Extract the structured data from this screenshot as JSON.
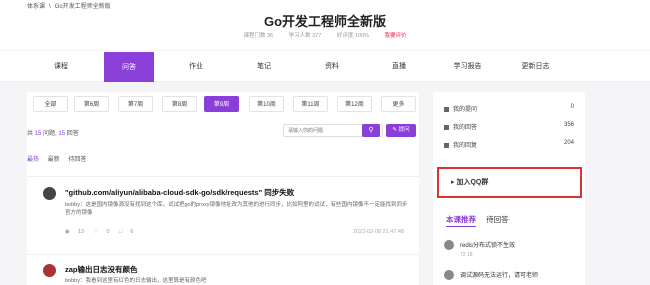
{
  "breadcrumb": {
    "home": "体系课",
    "sep": "\\",
    "current": "Go开发工程师全新版"
  },
  "course": {
    "title": "Go开发工程师全新版"
  },
  "stats": {
    "chapters": "课程门数 36",
    "learners": "学习人数 377",
    "rating": "好评度 100%",
    "rate_link": "我要评价"
  },
  "tabs": [
    "课程",
    "问答",
    "作业",
    "笔记",
    "资料",
    "直播",
    "学习报告",
    "更新日志"
  ],
  "filters": [
    "全部",
    "第6周",
    "第7周",
    "第8周",
    "第9周",
    "第10周",
    "第11周",
    "第12周",
    "更多"
  ],
  "summary": {
    "prefix": "共",
    "count1": "15",
    "mid": "问题,",
    "count2": "15",
    "suffix": "回答"
  },
  "search": {
    "placeholder": "请输入你的问题",
    "button_icon": "search-icon",
    "ask_label": "提问"
  },
  "sort": [
    "最热",
    "最新",
    "待回答"
  ],
  "questions": [
    {
      "title": "\"github.com/aliyun/alibaba-cloud-sdk-go/sdk/requests\" 同步失败",
      "body": "bobby：这是国内镜像源没有找到这个库，试试把go的proxy镜像地址改为其他的进行同步，比如阿里的试试，有些国内镜像不一定能找到同步官方的镜像",
      "views": "13",
      "likes": "0",
      "comments": "6",
      "date": "2023-02-08 21:47:48"
    },
    {
      "title": "zap输出日志没有颜色",
      "body": "bobby：我看到这里有红色的日志输出，这里算是有颜色吧"
    }
  ],
  "sidebar": {
    "rows": [
      {
        "label": "我的提问",
        "count": "0"
      },
      {
        "label": "我的回答",
        "count": "356"
      },
      {
        "label": "我的回复",
        "count": "204"
      }
    ],
    "qq_label": "加入QQ群",
    "tabs": [
      "本课推荐",
      "待回答"
    ],
    "recs": [
      {
        "title": "redis分布式锁不生效",
        "meta": "72   18"
      },
      {
        "title": "调试源码无法运行，请可老师",
        "meta": ""
      }
    ]
  },
  "colors": {
    "accent": "#8a3fd8",
    "highlight_border": "#d33"
  }
}
